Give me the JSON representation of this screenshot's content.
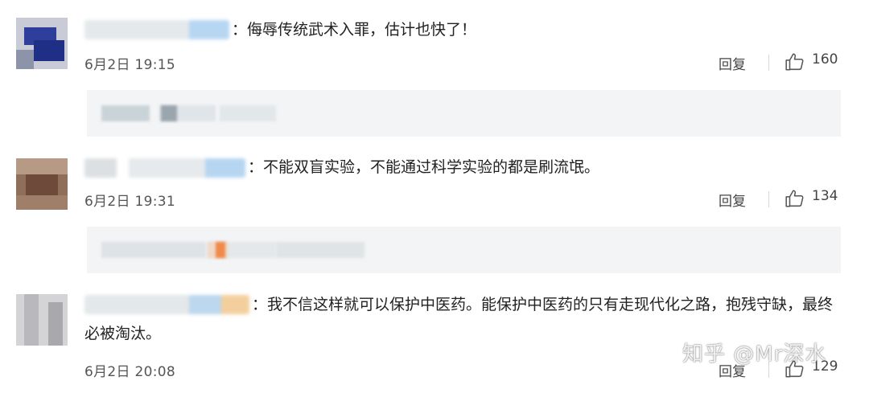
{
  "comments": [
    {
      "text": "：侮辱传统武术入罪，估计也快了！",
      "date": "6月2日 19:15",
      "reply_label": "回复",
      "likes": "160"
    },
    {
      "text": "：不能双盲实验，不能通过科学实验的都是刷流氓。",
      "date": "6月2日 19:31",
      "reply_label": "回复",
      "likes": "134"
    },
    {
      "text": "：我不信这样就可以保护中医药。能保护中医药的只有走现代化之路，抱残守缺，最终必被淘汰。",
      "date": "6月2日 20:08",
      "reply_label": "回复",
      "likes": "129"
    }
  ],
  "watermark": "知乎 @Mr深水",
  "icons": {
    "like": "thumbs-up-icon"
  },
  "colors": {
    "text": "#222222",
    "meta": "#555555",
    "subreply_bg": "#f3f4f6"
  }
}
